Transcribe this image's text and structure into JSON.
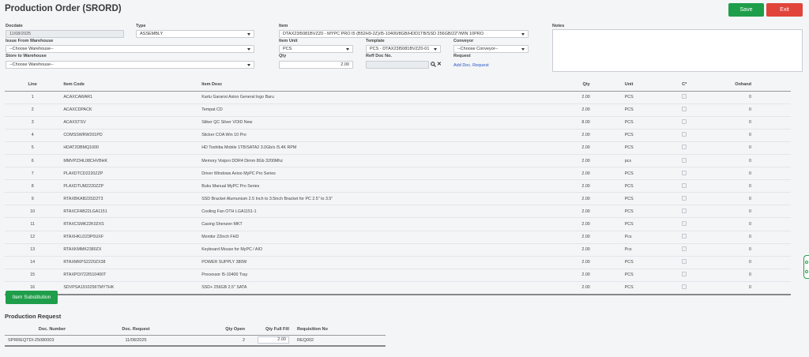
{
  "page_title": "Production Order (SRORD)",
  "buttons": {
    "save": "Save",
    "exit": "Exit",
    "item_substitution": "Item Substitution",
    "add_doc_request": "Add Doc. Request"
  },
  "form": {
    "docdate_label": "Docdate",
    "docdate_value": "11/08/2025",
    "type_label": "Type",
    "type_value": "ASSEMBLY",
    "item_label": "Item",
    "item_value": "DTAX23I5081BVZZ0 - MYPC PRO I5 (B52H9-2Z)/I5-10400/8GB/HDD1TB/SSD 256GB/22\"/WIN 10PRO",
    "notes_label": "Notes",
    "issue_from_label": "Issue From Warehouse",
    "issue_from_value": "--Choose Warehouse--",
    "item_unit_label": "Item Unit",
    "item_unit_value": "PCS",
    "template_label": "Template",
    "template_value": "PCS - DTAX23I5081BVZZ0-01",
    "conveyor_label": "Conveyor",
    "conveyor_value": "--Choose Conveyor--",
    "store_to_label": "Store to Warehouse",
    "store_to_value": "--Choose Warehouse--",
    "qty_label": "Qty",
    "qty_value": "2.00",
    "reff_label": "Reff Doc No.",
    "request_label": "Request"
  },
  "items_table": {
    "headers": {
      "line": "Line",
      "code": "Item Code",
      "desc": "Item Desc",
      "qty": "Qty",
      "unit": "Unit",
      "c": "C*",
      "onhand": "Onhand"
    },
    "rows": [
      {
        "line": "1",
        "code": "ACAXCAWAR1",
        "desc": "Kartu Garansi Axioo General logo Baru",
        "qty": "2.00",
        "unit": "PCS",
        "onhand": "0"
      },
      {
        "line": "2",
        "code": "ACAXCDPACK",
        "desc": "Tempat CD",
        "qty": "2.00",
        "unit": "PCS",
        "onhand": "0"
      },
      {
        "line": "3",
        "code": "ACAXSTSV",
        "desc": "Stiker QC Silver VOID New",
        "qty": "8.00",
        "unit": "PCS",
        "onhand": "0"
      },
      {
        "line": "4",
        "code": "COMSSWRW201PD",
        "desc": "Sticker COA Win 10 Pro",
        "qty": "2.00",
        "unit": "PCS",
        "onhand": "0"
      },
      {
        "line": "5",
        "code": "HDAT2DBMQ1000",
        "desc": "HD Toshiba Mobile 1TB/SATA2 3.0Gb/s /5.4K RPM",
        "qty": "2.00",
        "unit": "PCS",
        "onhand": "0"
      },
      {
        "line": "6",
        "code": "MMVP234L08CHVBHK",
        "desc": "Memory Visipro DDR4 Dimm 8Gb 3200Mhz",
        "qty": "2.00",
        "unit": "pcs",
        "onhand": "0"
      },
      {
        "line": "7",
        "code": "PLAXDTCD2220ZZP",
        "desc": "Driver Windows Axioo MyPC Pro Series",
        "qty": "2.00",
        "unit": "PCS",
        "onhand": "0"
      },
      {
        "line": "8",
        "code": "PLAXDTUM2220ZZP",
        "desc": "Buku Manual MyPC Pro Series",
        "qty": "2.00",
        "unit": "PCS",
        "onhand": "0"
      },
      {
        "line": "9",
        "code": "RTAXBKAB23SD2T3",
        "desc": "SSD Bracket Alumunium 2.5 Inch to 3.5inch Bracket for PC 2.5\" to 3.5\"",
        "qty": "2.00",
        "unit": "PCS",
        "onhand": "0"
      },
      {
        "line": "10",
        "code": "RTAXCFAB22LGA1151",
        "desc": "Cooling Fan OTH LGA1151-1",
        "qty": "2.00",
        "unit": "PCS",
        "onhand": "0"
      },
      {
        "line": "11",
        "code": "RTAXCSMK22K02XS",
        "desc": "Casing Shenzen MKT",
        "qty": "2.00",
        "unit": "PCS",
        "onhand": "0"
      },
      {
        "line": "12",
        "code": "RTAXHKLD23P0UXF",
        "desc": "Monitor 22inch FHD",
        "qty": "2.00",
        "unit": "Pcs",
        "onhand": "0"
      },
      {
        "line": "13",
        "code": "RTAXKMMK2380ZX",
        "desc": "Keyboard Mouse for MyPC / AIO",
        "qty": "2.00",
        "unit": "Pcs",
        "onhand": "0"
      },
      {
        "line": "14",
        "code": "RTAXMKPS2220ZX38",
        "desc": "POWER SUPPLY 380W",
        "qty": "2.00",
        "unit": "PCS",
        "onhand": "0"
      },
      {
        "line": "15",
        "code": "RTAXPOI722I510400T",
        "desc": "Processor I5-10400 Tray",
        "qty": "2.00",
        "unit": "PCS",
        "onhand": "0"
      },
      {
        "line": "16",
        "code": "SDVPSA1910256TMYTHK",
        "desc": "SSD+ 256GB 2.5\" SATA",
        "qty": "2.00",
        "unit": "PCS",
        "onhand": "0"
      }
    ]
  },
  "production_request": {
    "title": "Production Request",
    "headers": {
      "doc_number": "Doc. Number",
      "doc_request": "Doc. Request",
      "qty_open": "Qty Open",
      "qty_full_fill": "Qty Full Fill",
      "requisition_no": "Requisition No"
    },
    "row": {
      "doc_number": "SPRREQTDI-25080003",
      "doc_request": "11/08/2025",
      "qty_open": "2",
      "qty_full_fill": "2.00",
      "requisition_no": "REQ002"
    }
  },
  "colors": {
    "green": "#1e9e4a",
    "red": "#e0443a",
    "link": "#2a56c6"
  },
  "icons": [
    "search-icon",
    "clear-icon",
    "dropdown-caret-icon"
  ]
}
